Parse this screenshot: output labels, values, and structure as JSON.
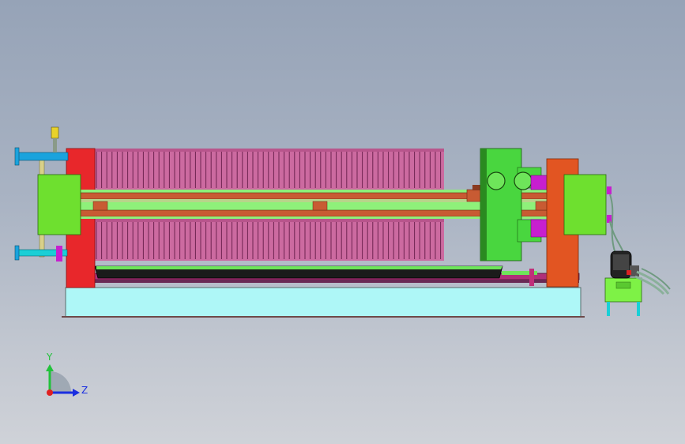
{
  "viewport": {
    "view": "side-elevation",
    "background_top": "#96a3b7",
    "background_bottom": "#cfd2d8"
  },
  "model": {
    "component": "filter-press",
    "colors": {
      "filter_plate": "#cc6aa0",
      "filter_plate_line": "#6e2450",
      "head_plate": "#e8272b",
      "tail_plate": "#e25522",
      "side_beam": "#c85b33",
      "beam_highlight": "#8ef07a",
      "trolley": "#49d63f",
      "base": "#aef7f7",
      "drip_tray": "#6a2a55",
      "pipe_blue": "#1aa3dd",
      "pipe_cyan": "#1acfd6",
      "hydraulic_tank": "#7ef246",
      "motor": "#222222",
      "hose": "#7fa58a",
      "cylinder_magenta": "#c71fcf"
    }
  },
  "triad": {
    "y_label": "Y",
    "z_label": "Z",
    "y_color": "#22c23b",
    "z_color": "#1a2ee0",
    "x_color": "#e02020"
  }
}
